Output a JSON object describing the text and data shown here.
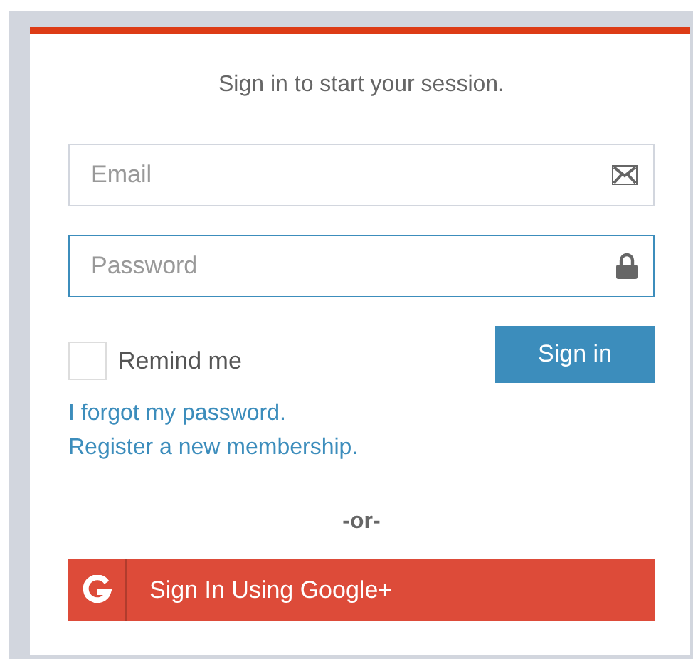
{
  "login_box": {
    "message": "Sign in to start your session.",
    "fields": [
      {
        "kind": "email",
        "placeholder": "Email",
        "focused": false
      },
      {
        "kind": "password",
        "placeholder": "Password",
        "focused": true
      }
    ],
    "remember": {
      "label": "Remind me",
      "checked": false
    },
    "submit": "Sign in",
    "links": [
      "I forgot my password.",
      "Register a new membership."
    ],
    "divider": "-or-",
    "social_button": "Sign In Using Google+"
  }
}
